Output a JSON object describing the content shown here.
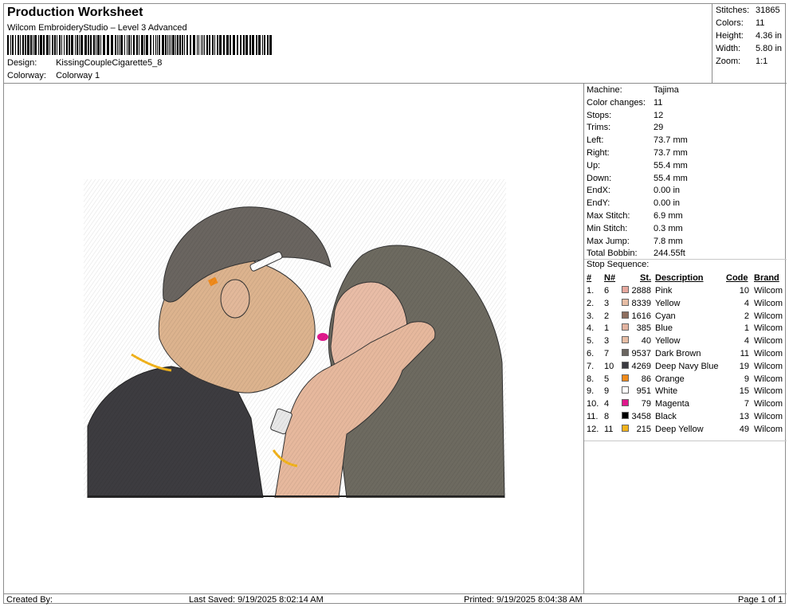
{
  "header": {
    "title": "Production Worksheet",
    "subtitle": "Wilcom EmbroideryStudio – Level 3 Advanced",
    "design_label": "Design:",
    "design_value": "KissingCoupleCigarette5_8",
    "colorway_label": "Colorway:",
    "colorway_value": "Colorway 1"
  },
  "summary": [
    {
      "label": "Stitches:",
      "value": "31865"
    },
    {
      "label": "Colors:",
      "value": "11"
    },
    {
      "label": "Height:",
      "value": "4.36 in"
    },
    {
      "label": "Width:",
      "value": "5.80 in"
    },
    {
      "label": "Zoom:",
      "value": "1:1"
    }
  ],
  "machine_info": [
    {
      "label": "Machine:",
      "value": "Tajima"
    },
    {
      "label": "Color changes:",
      "value": "11"
    },
    {
      "label": "Stops:",
      "value": "12"
    },
    {
      "label": "Trims:",
      "value": "29"
    },
    {
      "label": "Left:",
      "value": "73.7 mm"
    },
    {
      "label": "Right:",
      "value": "73.7 mm"
    },
    {
      "label": "Up:",
      "value": "55.4 mm"
    },
    {
      "label": "Down:",
      "value": "55.4 mm"
    },
    {
      "label": "EndX:",
      "value": "0.00 in"
    },
    {
      "label": "EndY:",
      "value": "0.00 in"
    },
    {
      "label": "Max Stitch:",
      "value": "6.9 mm"
    },
    {
      "label": "Min Stitch:",
      "value": "0.3 mm"
    },
    {
      "label": "Max Jump:",
      "value": "7.8 mm"
    },
    {
      "label": "Total Bobbin:",
      "value": "244.55ft"
    }
  ],
  "stop_sequence": {
    "title": "Stop Sequence:",
    "headers": {
      "index": "#",
      "needle": "N#",
      "stitches": "St.",
      "description": "Description",
      "code": "Code",
      "brand": "Brand"
    },
    "rows": [
      {
        "index": "1.",
        "needle": "6",
        "color": "#e7a89e",
        "stitches": "2888",
        "description": "Pink",
        "code": "10",
        "brand": "Wilcom"
      },
      {
        "index": "2.",
        "needle": "3",
        "color": "#e7bda4",
        "stitches": "8339",
        "description": "Yellow",
        "code": "4",
        "brand": "Wilcom"
      },
      {
        "index": "3.",
        "needle": "2",
        "color": "#8d6e5e",
        "stitches": "1616",
        "description": "Cyan",
        "code": "2",
        "brand": "Wilcom"
      },
      {
        "index": "4.",
        "needle": "1",
        "color": "#e2b3a0",
        "stitches": "385",
        "description": "Blue",
        "code": "1",
        "brand": "Wilcom"
      },
      {
        "index": "5.",
        "needle": "3",
        "color": "#e7bda4",
        "stitches": "40",
        "description": "Yellow",
        "code": "4",
        "brand": "Wilcom"
      },
      {
        "index": "6.",
        "needle": "7",
        "color": "#6a6560",
        "stitches": "9537",
        "description": "Dark Brown",
        "code": "11",
        "brand": "Wilcom"
      },
      {
        "index": "7.",
        "needle": "10",
        "color": "#3a3a40",
        "stitches": "4269",
        "description": "Deep Navy Blue",
        "code": "19",
        "brand": "Wilcom"
      },
      {
        "index": "8.",
        "needle": "5",
        "color": "#f08a1a",
        "stitches": "86",
        "description": "Orange",
        "code": "9",
        "brand": "Wilcom"
      },
      {
        "index": "9.",
        "needle": "9",
        "color": "#ffffff",
        "stitches": "951",
        "description": "White",
        "code": "15",
        "brand": "Wilcom"
      },
      {
        "index": "10.",
        "needle": "4",
        "color": "#e0188c",
        "stitches": "79",
        "description": "Magenta",
        "code": "7",
        "brand": "Wilcom"
      },
      {
        "index": "11.",
        "needle": "8",
        "color": "#000000",
        "stitches": "3458",
        "description": "Black",
        "code": "13",
        "brand": "Wilcom"
      },
      {
        "index": "12.",
        "needle": "11",
        "color": "#f2b31c",
        "stitches": "215",
        "description": "Deep Yellow",
        "code": "49",
        "brand": "Wilcom"
      }
    ]
  },
  "footer": {
    "created_by": "Created By:",
    "last_saved": "Last Saved: 9/19/2025 8:02:14 AM",
    "printed": "Printed: 9/19/2025 8:04:38 AM",
    "page": "Page 1 of 1"
  }
}
